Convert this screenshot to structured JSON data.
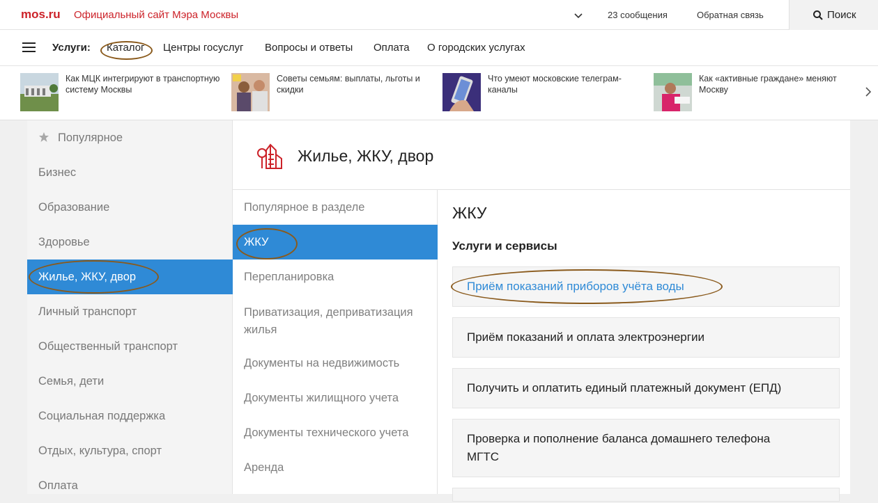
{
  "topbar": {
    "logo": "mos.ru",
    "site_title": "Официальный сайт Мэра Москвы",
    "messages": "23 сообщения",
    "feedback": "Обратная связь",
    "search": "Поиск"
  },
  "nav": {
    "label": "Услуги:",
    "items": [
      "Каталог",
      "Центры госуслуг",
      "Вопросы и ответы",
      "Оплата",
      "О городских услугах"
    ]
  },
  "news": [
    {
      "text": "Как МЦК интегрируют в транспортную систему Москвы"
    },
    {
      "text": "Советы семьям: выплаты, льготы и скидки"
    },
    {
      "text": "Что умеют московские телеграм-каналы"
    },
    {
      "text": "Как «активные граждане» меняют Москву"
    }
  ],
  "categories": [
    "Популярное",
    "Бизнес",
    "Образование",
    "Здоровье",
    "Жилье, ЖКУ, двор",
    "Личный транспорт",
    "Общественный транспорт",
    "Семья, дети",
    "Социальная поддержка",
    "Отдых, культура, спорт",
    "Оплата"
  ],
  "section": {
    "title": "Жилье, ЖКУ, двор"
  },
  "subcategories": [
    "Популярное в разделе",
    "ЖКУ",
    "Перепланировка",
    "Приватизация, деприватизация жилья",
    "Документы на недвижимость",
    "Документы жилищного учета",
    "Документы технического учета",
    "Аренда"
  ],
  "content": {
    "title": "ЖКУ",
    "subtitle": "Услуги и сервисы",
    "services": [
      "Приём показаний приборов учёта воды",
      "Приём показаний и оплата электроэнергии",
      "Получить и оплатить единый платежный документ (ЕПД)",
      "Проверка и пополнение баланса домашнего телефона МГТС"
    ]
  },
  "colors": {
    "brand": "#cc2229",
    "accent": "#2f8ad6",
    "annotation": "#8a5a1c"
  }
}
